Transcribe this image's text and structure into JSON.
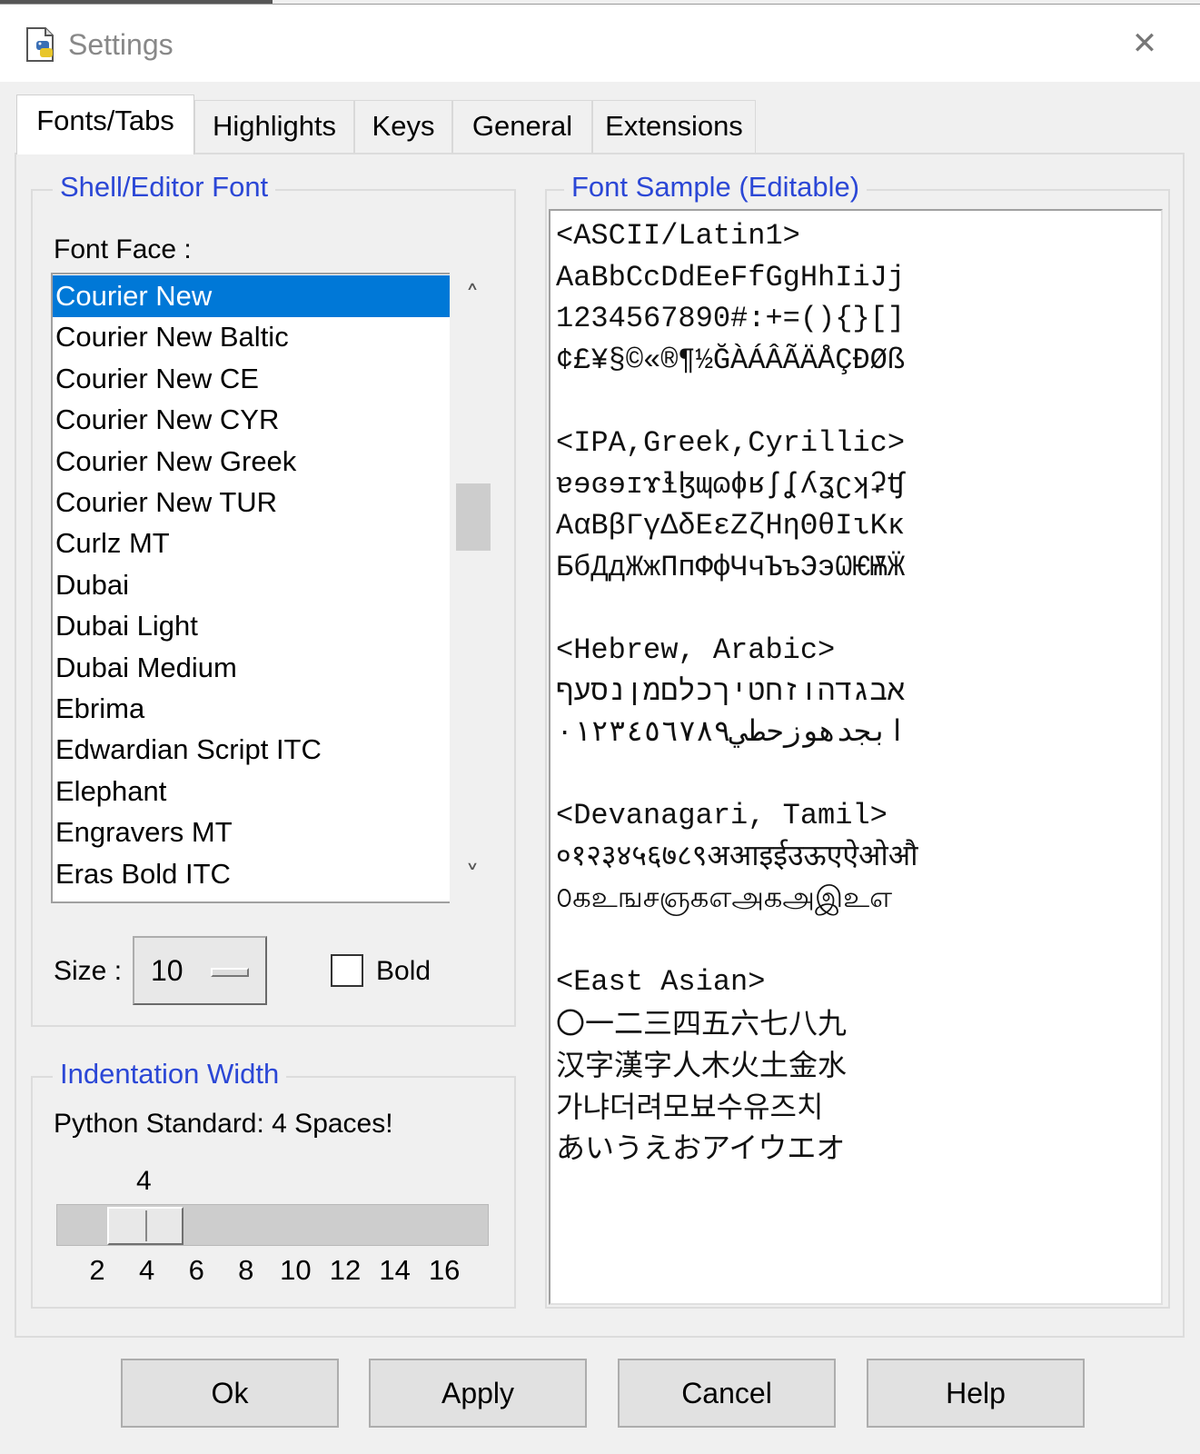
{
  "window": {
    "title": "Settings"
  },
  "tabs": [
    {
      "label": "Fonts/Tabs"
    },
    {
      "label": "Highlights"
    },
    {
      "label": "Keys"
    },
    {
      "label": "General"
    },
    {
      "label": "Extensions"
    }
  ],
  "font_group": {
    "legend": "Shell/Editor Font",
    "face_label": "Font Face :",
    "fonts": [
      "Courier New",
      "Courier New Baltic",
      "Courier New CE",
      "Courier New CYR",
      "Courier New Greek",
      "Courier New TUR",
      "Curlz MT",
      "Dubai",
      "Dubai Light",
      "Dubai Medium",
      "Ebrima",
      "Edwardian Script ITC",
      "Elephant",
      "Engravers MT",
      "Eras Bold ITC"
    ],
    "selected_font": "Courier New",
    "size_label": "Size :",
    "size_value": "10",
    "bold_label": "Bold",
    "bold_checked": false,
    "scroll_up_icon": "chevron-up-icon",
    "scroll_down_icon": "chevron-down-icon"
  },
  "indent_group": {
    "legend": "Indentation Width",
    "note": "Python Standard: 4 Spaces!",
    "value_label": "4",
    "value": 4,
    "min": 2,
    "max": 16,
    "ticks": [
      "2",
      "4",
      "6",
      "8",
      "10",
      "12",
      "14",
      "16"
    ]
  },
  "sample_group": {
    "legend": "Font Sample (Editable)",
    "lines": [
      "<ASCII/Latin1>",
      "AaBbCcDdEeFfGgHhIiJj",
      "1234567890#:+=(){}[]",
      "¢£¥§©«®¶½ĞÀÁÂÃÄÅÇÐØß",
      "",
      "<IPA,Greek,Cyrillic>",
      "ɐɘɞɘɪɤɬɮɰɷɸʁʃʆʎʓʗʞʡʧ",
      "ΑαΒβΓγΔδΕεΖζΗηΘθΙιΚκ",
      "БбДдЖжПпФфЧчЪъЭэѠѤѬӜ",
      "",
      "<Hebrew, Arabic>",
      "אבגדהוזחטיךכלםמןנסעף",
      "ابجدهوزحطي٠١٢٣٤٥٦٧٨٩",
      "",
      "<Devanagari, Tamil>",
      "०१२३४५६७८९अआइईउऊएऐओऔ",
      "௦கஉஙசஞகஎஅகஅஇஉஎ",
      "",
      "<East Asian>",
      "〇一二三四五六七八九",
      "汉字漢字人木火土金水",
      "가냐더려모뵤수유즈치",
      "あいうえおアイウエオ"
    ]
  },
  "buttons": {
    "ok": "Ok",
    "apply": "Apply",
    "cancel": "Cancel",
    "help": "Help"
  },
  "colors": {
    "selection": "#0078d7",
    "legend": "#2b47d6",
    "dialog_bg": "#f0f0f0"
  },
  "icons": {
    "app": "python-idle-icon",
    "close": "close-icon"
  }
}
